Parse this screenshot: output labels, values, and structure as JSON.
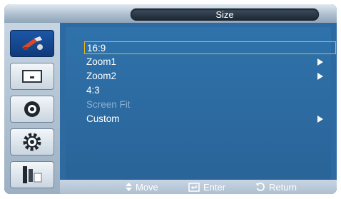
{
  "title": "Size",
  "menu": [
    {
      "label": "16:9",
      "selected": true,
      "disabled": false,
      "has_submenu": false
    },
    {
      "label": "Zoom1",
      "selected": false,
      "disabled": false,
      "has_submenu": true
    },
    {
      "label": "Zoom2",
      "selected": false,
      "disabled": false,
      "has_submenu": true
    },
    {
      "label": "4:3",
      "selected": false,
      "disabled": false,
      "has_submenu": false
    },
    {
      "label": "Screen Fit",
      "selected": false,
      "disabled": true,
      "has_submenu": false
    },
    {
      "label": "Custom",
      "selected": false,
      "disabled": false,
      "has_submenu": true
    }
  ],
  "sidebar": {
    "icons": [
      "picture-settings-icon",
      "screen-input-icon",
      "sound-icon",
      "setup-gear-icon",
      "multi-window-icon"
    ]
  },
  "hints": {
    "move": "Move",
    "enter": "Enter",
    "return": "Return"
  },
  "colors": {
    "highlight_border": "#f1b51b",
    "menu_bg": "#2c6aa1",
    "disabled_text": "#8bb0d3"
  }
}
